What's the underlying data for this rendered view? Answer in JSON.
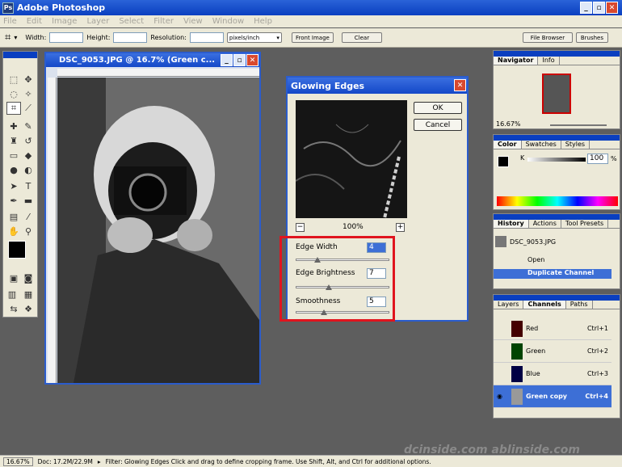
{
  "app": {
    "title": "Adobe Photoshop"
  },
  "menu": [
    "File",
    "Edit",
    "Image",
    "Layer",
    "Select",
    "Filter",
    "View",
    "Window",
    "Help"
  ],
  "options": {
    "width_label": "Width:",
    "height_label": "Height:",
    "resolution_label": "Resolution:",
    "units": "pixels/inch",
    "front_image": "Front Image",
    "clear": "Clear",
    "file_browser": "File Browser",
    "brushes": "Brushes"
  },
  "document": {
    "title": "DSC_9053.JPG @ 16.7% (Green c..."
  },
  "dialog": {
    "title": "Glowing Edges",
    "ok": "OK",
    "cancel": "Cancel",
    "zoom": "100%",
    "edge_width_label": "Edge Width",
    "edge_width": "4",
    "edge_brightness_label": "Edge Brightness",
    "edge_brightness": "7",
    "smoothness_label": "Smoothness",
    "smoothness": "5"
  },
  "navigator": {
    "tabs": [
      "Navigator",
      "Info"
    ],
    "zoom": "16.67%"
  },
  "color": {
    "tabs": [
      "Color",
      "Swatches",
      "Styles"
    ],
    "k_label": "K",
    "k_value": "100",
    "pct": "%"
  },
  "history": {
    "tabs": [
      "History",
      "Actions",
      "Tool Presets"
    ],
    "snapshot": "DSC_9053.JPG",
    "items": [
      "Open",
      "Duplicate Channel"
    ]
  },
  "channels": {
    "tabs": [
      "Layers",
      "Channels",
      "Paths"
    ],
    "rows": [
      {
        "name": "Red",
        "key": "Ctrl+1"
      },
      {
        "name": "Green",
        "key": "Ctrl+2"
      },
      {
        "name": "Blue",
        "key": "Ctrl+3"
      },
      {
        "name": "Green copy",
        "key": "Ctrl+4"
      }
    ]
  },
  "status": {
    "zoom": "16.67%",
    "doc": "Doc: 17.2M/22.9M",
    "message": "Filter: Glowing Edges   Click and drag to define cropping frame. Use Shift, Alt, and Ctrl for additional options."
  },
  "watermark": "dcinside.com  ablinside.com"
}
